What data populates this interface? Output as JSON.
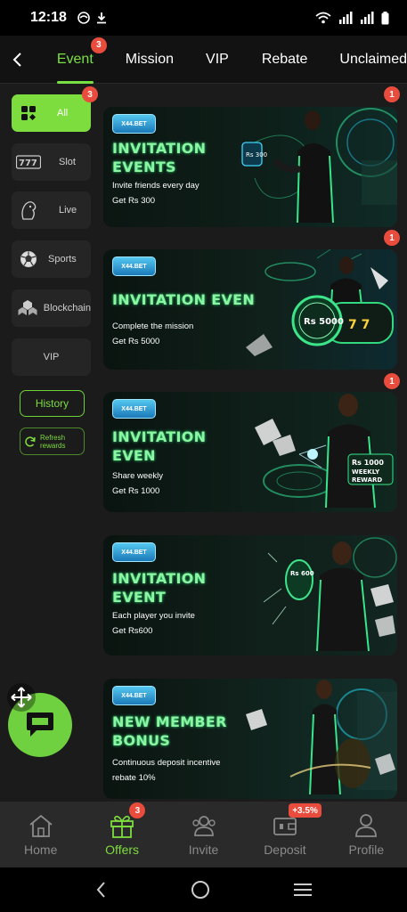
{
  "status_bar": {
    "time": "12:18"
  },
  "top_nav": {
    "tabs": [
      {
        "label": "Event",
        "badge": "3",
        "active": true
      },
      {
        "label": "Mission"
      },
      {
        "label": "VIP"
      },
      {
        "label": "Rebate"
      },
      {
        "label": "Unclaimed"
      }
    ]
  },
  "sidebar": {
    "categories": [
      {
        "label": "All",
        "badge": "3",
        "icon": "grid-icon",
        "active": true
      },
      {
        "label": "Slot",
        "icon": "slot-777-icon"
      },
      {
        "label": "Live",
        "icon": "live-dealer-icon"
      },
      {
        "label": "Sports",
        "icon": "soccer-ball-icon"
      },
      {
        "label": "Blockchain",
        "icon": "blockchain-icon"
      },
      {
        "label": "VIP"
      }
    ],
    "history_label": "History",
    "refresh_label_line1": "Refresh",
    "refresh_label_line2": "rewards"
  },
  "banners": [
    {
      "logo": "X44.BET",
      "title_lines": [
        "INVITATION",
        "EVENTS"
      ],
      "desc_lines": [
        "Invite friends every day",
        "Get Rs 300"
      ],
      "badge": "1",
      "art_text": "Rs 300"
    },
    {
      "logo": "X44.BET",
      "title_lines": [
        "INVITATION EVEN"
      ],
      "desc_lines": [
        "Complete the mission",
        "Get Rs 5000"
      ],
      "badge": "1",
      "art_text": "Rs 5000"
    },
    {
      "logo": "X44.BET",
      "title_lines": [
        "INVITATION",
        "EVEN"
      ],
      "desc_lines": [
        "Share weekly",
        "Get Rs 1000"
      ],
      "badge": "1",
      "art_text_1": "Rs 1000",
      "art_text_2": "WEEKLY",
      "art_text_3": "REWARD"
    },
    {
      "logo": "X44.BET",
      "title_lines": [
        "INVITATION",
        "EVENT"
      ],
      "desc_lines": [
        "Each player you invite",
        "Get Rs600"
      ],
      "art_text": "Rs 600"
    },
    {
      "logo": "X44.BET",
      "title_lines": [
        "NEW MEMBER",
        "BONUS"
      ],
      "desc_lines": [
        "Continuous deposit incentive",
        "rebate 10%"
      ]
    }
  ],
  "bottom_nav": {
    "items": [
      {
        "label": "Home",
        "icon": "home-icon"
      },
      {
        "label": "Offers",
        "icon": "gift-icon",
        "badge": "3",
        "active": true
      },
      {
        "label": "Invite",
        "icon": "invite-people-icon"
      },
      {
        "label": "Deposit",
        "icon": "deposit-icon",
        "badge": "+3.5%"
      },
      {
        "label": "Profile",
        "icon": "profile-icon"
      }
    ]
  },
  "colors": {
    "accent": "#7ddc3e",
    "badge": "#e94b3c",
    "title_green": "#8bf5a1"
  }
}
